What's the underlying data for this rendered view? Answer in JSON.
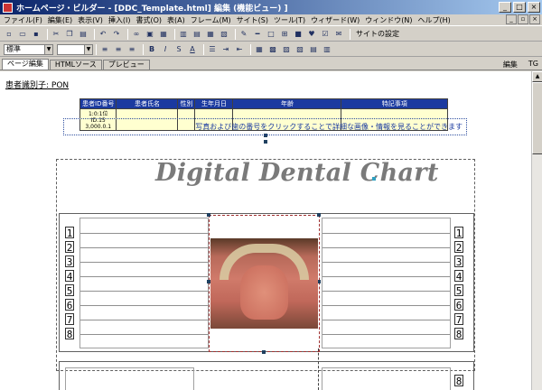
{
  "window": {
    "title": "ホームページ・ビルダー - [DDC_Template.html] 編集 (機能ビュー) ]",
    "min": "_",
    "max": "□",
    "close": "×"
  },
  "menu": [
    "ファイル(F)",
    "編集(E)",
    "表示(V)",
    "挿入(I)",
    "書式(O)",
    "表(A)",
    "フレーム(M)",
    "サイト(S)",
    "ツール(T)",
    "ウィザード(W)",
    "ウィンドウ(N)",
    "ヘルプ(H)"
  ],
  "toolbar2": {
    "style_value": "標準",
    "font_value": ""
  },
  "toolbar1_right_label": "サイトの設定",
  "tabs": [
    "ページ編集",
    "HTMLソース",
    "プレビュー"
  ],
  "tab_right": [
    "編集",
    "TG"
  ],
  "doc": {
    "attr_line": "患者識別子: PON",
    "table_headers": [
      "患者ID番号",
      "患者氏名",
      "性別",
      "生年月日",
      "年齢",
      "特記事項"
    ],
    "table_first_cell": "1:0:1位ID.15 3,000.0.1",
    "chart_title": "Digital Dental Chart",
    "instruction": "写真および歯の番号をクリックすることで詳細な画像・情報を見ることができます",
    "tooth_numbers_left": [
      "1",
      "2",
      "3",
      "4",
      "5",
      "6",
      "7",
      "8"
    ],
    "tooth_numbers_right": [
      "1",
      "2",
      "3",
      "4",
      "5",
      "6",
      "7",
      "8"
    ],
    "lower_number": "8"
  },
  "colors": {
    "title_grad_start": "#0a246a",
    "table_header": "#1b3aa0",
    "table_cell": "#ffffd0",
    "title_text": "#7a7a7a"
  }
}
